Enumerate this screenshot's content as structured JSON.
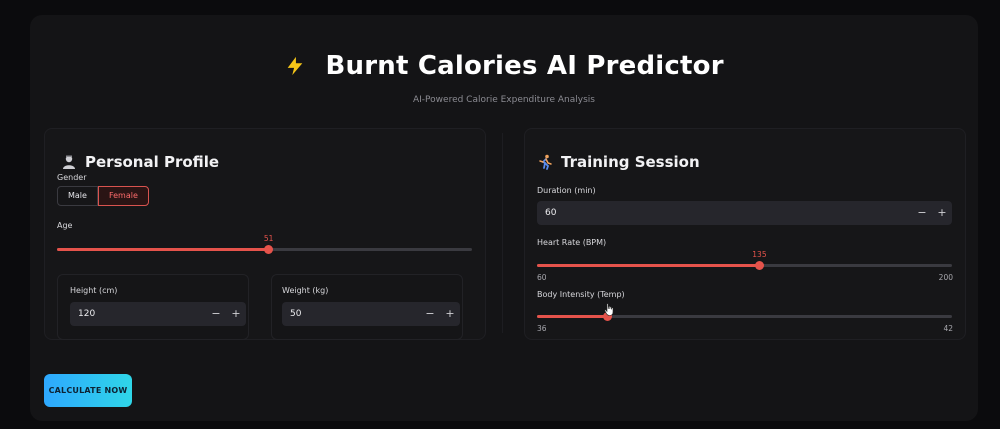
{
  "header": {
    "title": "Burnt Calories AI Predictor",
    "subtitle": "AI-Powered Calorie Expenditure Analysis",
    "title_icon": "lightning-icon"
  },
  "personal_profile": {
    "heading": "Personal Profile",
    "heading_icon": "bust-icon",
    "gender": {
      "label": "Gender",
      "options": [
        "Male",
        "Female"
      ],
      "selected": "Female"
    },
    "age": {
      "label": "Age",
      "value": "51",
      "fraction": 0.51
    },
    "height": {
      "label": "Height (cm)",
      "value": "120"
    },
    "weight": {
      "label": "Weight (kg)",
      "value": "50"
    }
  },
  "training_session": {
    "heading": "Training Session",
    "heading_icon": "runner-icon",
    "duration": {
      "label": "Duration (min)",
      "value": "60"
    },
    "heart_rate": {
      "label": "Heart Rate (BPM)",
      "value": "135",
      "min": "60",
      "max": "200",
      "fraction": 0.536
    },
    "body_intensity": {
      "label": "Body Intensity (Temp)",
      "min": "36",
      "max": "42",
      "fraction": 0.17
    }
  },
  "stepper": {
    "minus": "−",
    "plus": "+"
  },
  "actions": {
    "calculate_label": "CALCULATE NOW"
  },
  "colors": {
    "accent": "#e5534b",
    "cta_start": "#2ea8ff",
    "cta_end": "#2fd6e8",
    "background": "#141416"
  }
}
